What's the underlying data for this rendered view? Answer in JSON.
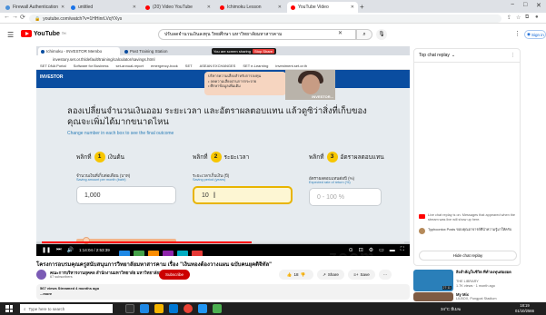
{
  "browser": {
    "tabs": [
      {
        "label": "Firewall Authentication",
        "color": "#4a90d9",
        "active": false
      },
      {
        "label": "untitled",
        "color": "#1a73e8",
        "active": false
      },
      {
        "label": "(20) Video YouTube",
        "color": "#ff0000",
        "active": false
      },
      {
        "label": "Ichimoku Lesson",
        "color": "#ff0000",
        "active": false
      },
      {
        "label": "YouTube Video",
        "color": "#ff0000",
        "active": true
      }
    ],
    "new_tab": "+",
    "window_controls": [
      "−",
      "□",
      "✕"
    ],
    "url": "youtube.com/watch?v=1HHinrLVqYXys"
  },
  "youtube": {
    "logo_text": "YouTube",
    "logo_suffix": "TH",
    "search_value": "ปรับลดจำนวนเงินลงทุน วิทยศึกษา มหาวิทยาลัยมหาสารคาม",
    "sign_in": "Sign in"
  },
  "player": {
    "inner_tabs": [
      {
        "label": "Ichimoku - INVESTOR Membo",
        "active": true
      },
      {
        "label": "Past Training Station",
        "active": false
      }
    ],
    "share_banner": "You are screen sharing",
    "stop_share": "Stop Share",
    "inner_url": "investory.set.or.th/default/training/calculator/savings.html",
    "bookmarks": [
      "SET DNA Portal",
      "Software for Business",
      "set-annual-report",
      "emergency-book",
      "SET",
      "ASEAN EXCHANGES",
      "SET e-Learning",
      "investment.set.or.th"
    ],
    "site_logo": "INVESTOR",
    "bubble_lines": [
      "บริหารความเสี่ยงสำหรับการลงทุน",
      "• ลดความเสี่ยงผ่านการกระจาย",
      "• ศึกษาข้อมูลเพิ่มเติม"
    ],
    "cam_label": "INVESTOR...",
    "slide_title": "ลองเปลี่ยนจำนวนเงินออม ระยะเวลา และอัตราผลตอบแทน แล้วดูซิว่าสิ่งที่เก็บของคุณจะเพิ่มได้มากขนาดไหน",
    "slide_subtitle": "Change number in each box to see the final outcome",
    "steps": [
      {
        "num": "1",
        "title": "เงินต้น",
        "label": "จำนวนเงินที่เก็บต่อเดือน (บาท)",
        "sublabel": "Saving amount per month (baht)",
        "value": "1,000"
      },
      {
        "num": "2",
        "title": "ระยะเวลา",
        "label": "ระยะเวลาเก็บเงิน (ปี)",
        "sublabel": "Saving period (years)",
        "value": "10"
      },
      {
        "num": "3",
        "title": "อัตราผลตอบแทน",
        "label": "อัตราผลตอบแทนต่อปี (%)",
        "sublabel": "Expected rate of return (%)",
        "value": "0 - 100 %"
      }
    ],
    "step_word": "พลิกที่",
    "slider_value_fraction": 0.1,
    "zoom_watermark": "zoom",
    "progress_fraction": 0.58,
    "time": "1:14:04 / 2:53:39"
  },
  "video": {
    "title": "โครงการอบรมคุณครูสนับสนุนการวิทยาลัยมหาสารคาม เรื่อง \"เงินทองต้องวางแผน ฉบับคนยุคดิจิทัล\"",
    "channel": "คณะการบริหารงานยุคคล สำนักงานมหาวิทยาลัย มหาวิทยาลัยมหาสารคาม",
    "subscribers": "67 subscribers",
    "subscribe": "Subscribe",
    "likes": "18",
    "share": "Share",
    "save": "Save",
    "more": "···",
    "views": "567 views  Streamed 4 months ago",
    "desc_more": "...more"
  },
  "sidebar": {
    "chat_header": "Top chat replay",
    "chat_note": "Live chat replay is on. Messages that appeared when the stream was live will show up here.",
    "chat_message": "Typhoontox Posts ขอบคุณอาจารย์ที่นำความรู้มาให้ครับ",
    "hide_chat": "Hide chat replay",
    "recommendations": [
      {
        "title": "สิ่งสำคัญในชีวิต ที่ทำลงทุนต่อยอด",
        "channel": "THE LIBRARY",
        "views": "1.7K views · 1 month ago",
        "duration": "27:11",
        "color": "#2a7fb9"
      },
      {
        "title": "My Mix",
        "channel": "LILBOX, Pongpat Stadium",
        "views": "",
        "duration": "",
        "color": "#7e5b44"
      }
    ]
  },
  "taskbar": {
    "search_placeholder": "Type here to search",
    "weather": "34°C มีเมฆ",
    "time": "18:19",
    "date": "01/10/2566"
  }
}
